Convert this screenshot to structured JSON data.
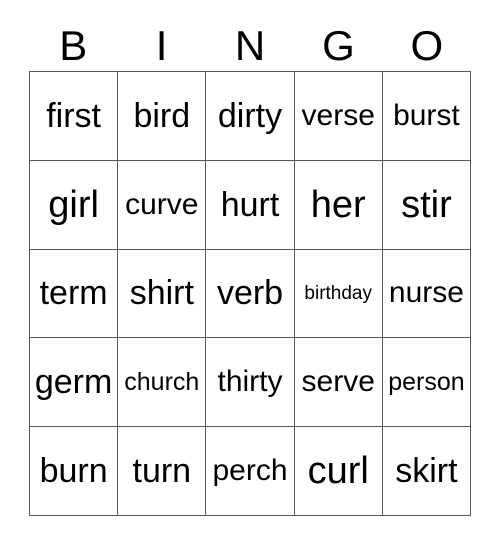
{
  "card": {
    "title": "BINGO",
    "header_letters": [
      "B",
      "I",
      "N",
      "G",
      "O"
    ],
    "columns": 5,
    "rows": 5,
    "border_color": "#595959",
    "text_color": "#000000",
    "background_color": "#ffffff",
    "grid": [
      [
        {
          "word": "first",
          "size": "lg"
        },
        {
          "word": "bird",
          "size": "lg"
        },
        {
          "word": "dirty",
          "size": "lg"
        },
        {
          "word": "verse",
          "size": "md"
        },
        {
          "word": "burst",
          "size": "md"
        }
      ],
      [
        {
          "word": "girl",
          "size": "xl"
        },
        {
          "word": "curve",
          "size": "md"
        },
        {
          "word": "hurt",
          "size": "lg"
        },
        {
          "word": "her",
          "size": "xl"
        },
        {
          "word": "stir",
          "size": "xl"
        }
      ],
      [
        {
          "word": "term",
          "size": "lg"
        },
        {
          "word": "shirt",
          "size": "lg"
        },
        {
          "word": "verb",
          "size": "lg"
        },
        {
          "word": "birthday",
          "size": "xs"
        },
        {
          "word": "nurse",
          "size": "md"
        }
      ],
      [
        {
          "word": "germ",
          "size": "lg"
        },
        {
          "word": "church",
          "size": "sm"
        },
        {
          "word": "thirty",
          "size": "md"
        },
        {
          "word": "serve",
          "size": "md"
        },
        {
          "word": "person",
          "size": "sm"
        }
      ],
      [
        {
          "word": "burn",
          "size": "lg"
        },
        {
          "word": "turn",
          "size": "lg"
        },
        {
          "word": "perch",
          "size": "md"
        },
        {
          "word": "curl",
          "size": "xl"
        },
        {
          "word": "skirt",
          "size": "lg"
        }
      ]
    ]
  }
}
